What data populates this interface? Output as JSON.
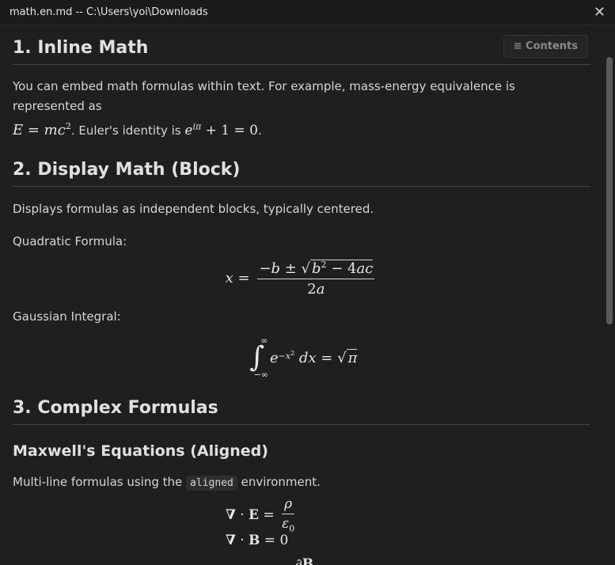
{
  "window": {
    "title": "math.en.md -- C:\\Users\\yoi\\Downloads",
    "close_glyph": "✕"
  },
  "toolbar": {
    "contents_label": "≡ Contents"
  },
  "sections": {
    "s1": {
      "heading": "1. Inline Math",
      "text1": "You can embed math formulas within text. For example, mass-energy equivalence is represented as",
      "text2": ". Euler's identity is",
      "text3": "."
    },
    "s2": {
      "heading": "2. Display Math (Block)",
      "intro": "Displays formulas as independent blocks, typically centered.",
      "quadratic_label": "Quadratic Formula:",
      "gaussian_label": "Gaussian Integral:"
    },
    "s3": {
      "heading": "3. Complex Formulas",
      "subheading": "Maxwell's Equations (Aligned)",
      "text_before": "Multi-line formulas using the",
      "code": "aligned",
      "text_after": "environment."
    }
  }
}
